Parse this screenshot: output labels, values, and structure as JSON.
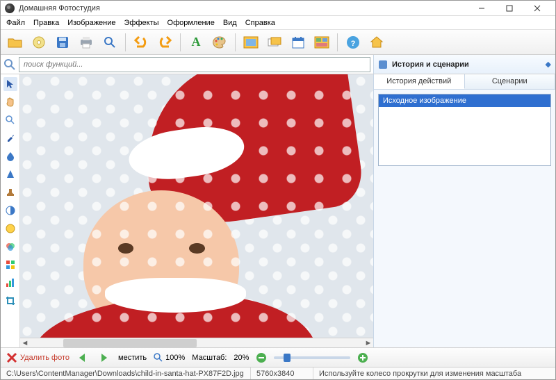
{
  "window": {
    "title": "Домашняя Фотостудия"
  },
  "menu": {
    "items": [
      "Файл",
      "Правка",
      "Изображение",
      "Эффекты",
      "Оформление",
      "Вид",
      "Справка"
    ]
  },
  "toolbar_icons": [
    "open-folder-icon",
    "cd-disc-icon",
    "save-icon",
    "print-icon",
    "zoom-icon",
    "undo-icon",
    "redo-icon",
    "text-tool-icon",
    "palette-icon",
    "frame-icon",
    "layers-icon",
    "calendar-icon",
    "collage-icon",
    "help-icon",
    "home-icon"
  ],
  "search": {
    "placeholder": "поиск функций..."
  },
  "left_tools": [
    "pointer-icon",
    "hand-icon",
    "zoom-icon",
    "eyedropper-icon",
    "drop-icon",
    "cone-icon",
    "stamp-icon",
    "contrast-icon",
    "hue-icon",
    "channels-icon",
    "color-balance-icon",
    "levels-icon",
    "crop-icon"
  ],
  "panel": {
    "title": "История и сценарии",
    "tabs": [
      "История действий",
      "Сценарии"
    ],
    "history_item": "Исходное изображение"
  },
  "bottom": {
    "delete": "Удалить фото",
    "fit": "местить",
    "zoom100": "100%",
    "scale_label": "Масштаб:",
    "scale_value": "20%"
  },
  "status": {
    "path": "C:\\Users\\ContentManager\\Downloads\\child-in-santa-hat-PX87F2D.jpg",
    "dimensions": "5760x3840",
    "hint": "Используйте колесо прокрутки для изменения масштаба"
  }
}
